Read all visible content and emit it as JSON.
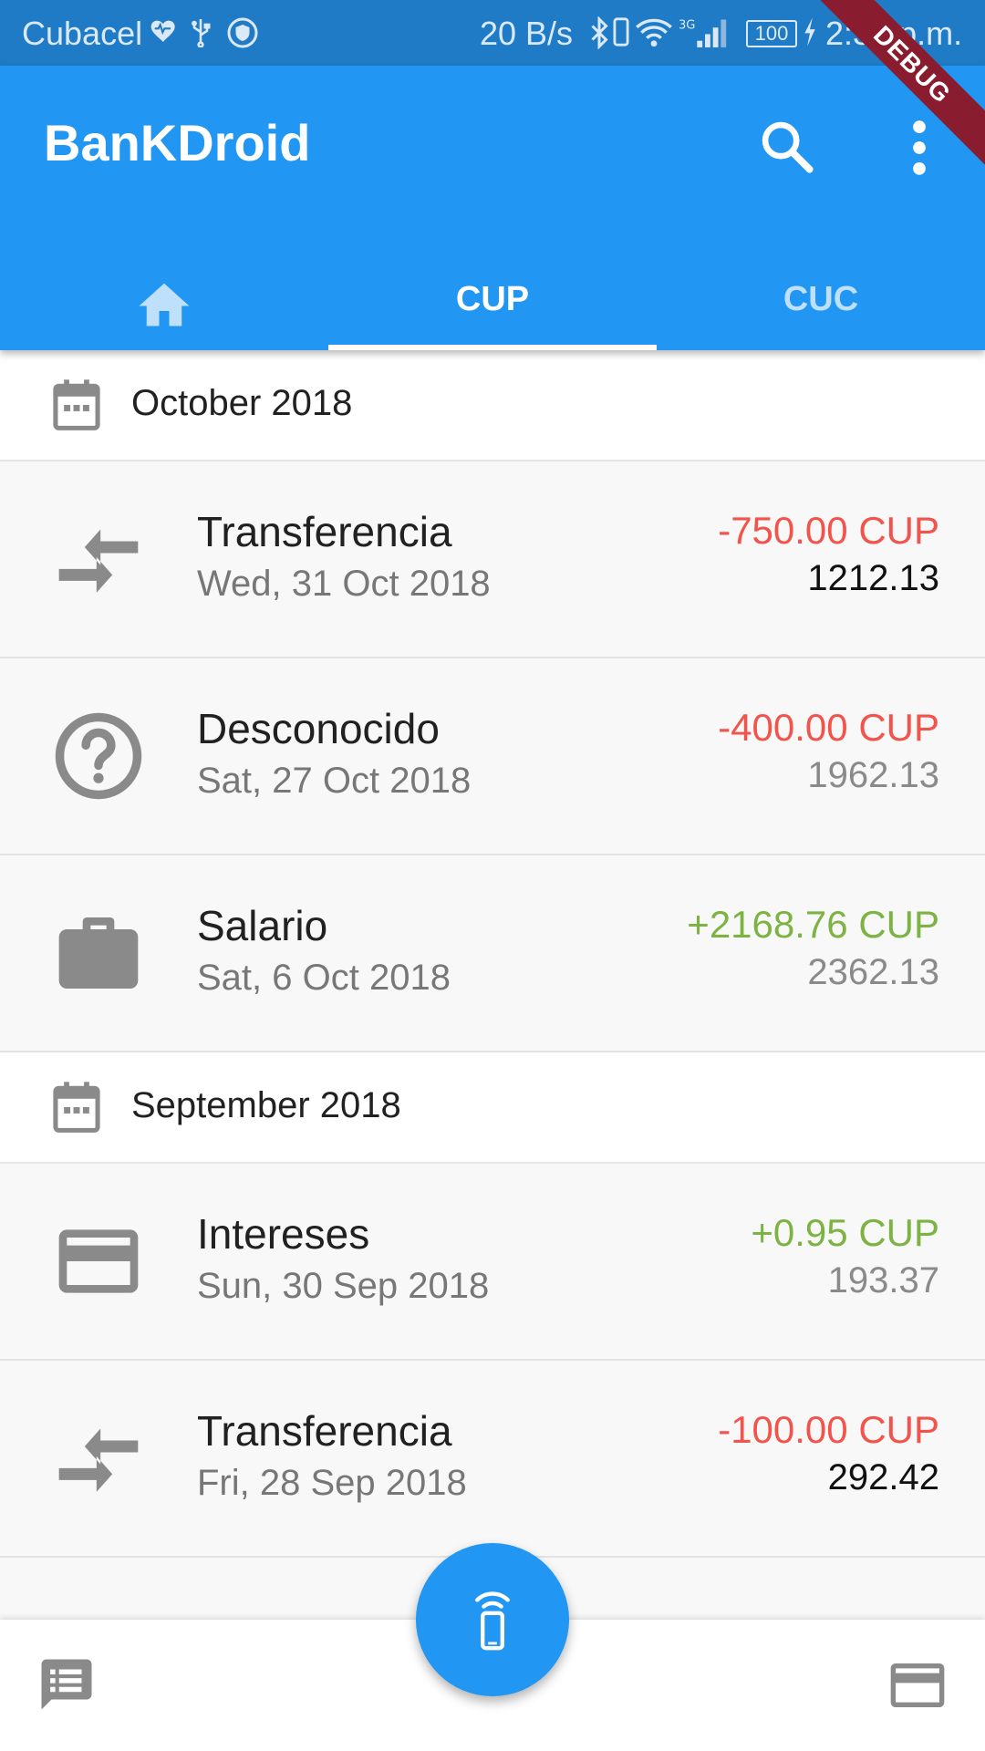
{
  "status_bar": {
    "carrier": "Cubacel",
    "net_speed": "20 B/s",
    "battery": "100",
    "time": "2:32 p.m."
  },
  "debug_banner": "DEBUG",
  "app_bar": {
    "title": "BanKDroid",
    "icons": [
      "search-icon",
      "more-vert-icon"
    ]
  },
  "tabs": [
    {
      "icon": "home-icon",
      "label": ""
    },
    {
      "label": "CUP",
      "selected": true
    },
    {
      "label": "CUC"
    }
  ],
  "sections": [
    {
      "month": "October 2018",
      "transactions": [
        {
          "icon": "transfer-icon",
          "title": "Transferencia",
          "date": "Wed, 31 Oct 2018",
          "amount": "-750.00 CUP",
          "balance": "1212.13"
        },
        {
          "icon": "help-circle-icon",
          "title": "Desconocido",
          "date": "Sat, 27 Oct 2018",
          "amount": "-400.00 CUP",
          "balance": "1962.13"
        },
        {
          "icon": "briefcase-icon",
          "title": "Salario",
          "date": "Sat, 6 Oct 2018",
          "amount": "+2168.76 CUP",
          "balance": "2362.13"
        }
      ]
    },
    {
      "month": "September 2018",
      "transactions": [
        {
          "icon": "credit-card-icon",
          "title": "Intereses",
          "date": "Sun, 30 Sep 2018",
          "amount": "+0.95 CUP",
          "balance": "193.37"
        },
        {
          "icon": "transfer-icon",
          "title": "Transferencia",
          "date": "Fri, 28 Sep 2018",
          "amount": "-100.00 CUP",
          "balance": "292.42"
        }
      ]
    }
  ],
  "bottom_bar": {
    "left_icon": "message-list-icon",
    "right_icon": "credit-card-icon",
    "fab_icon": "mobile-signal-icon"
  },
  "colors": {
    "primary": "#2196f3",
    "status_bar": "#1f7bc6",
    "negative": "#f2544b",
    "positive": "#7cb342",
    "debug": "#8a1c30"
  }
}
